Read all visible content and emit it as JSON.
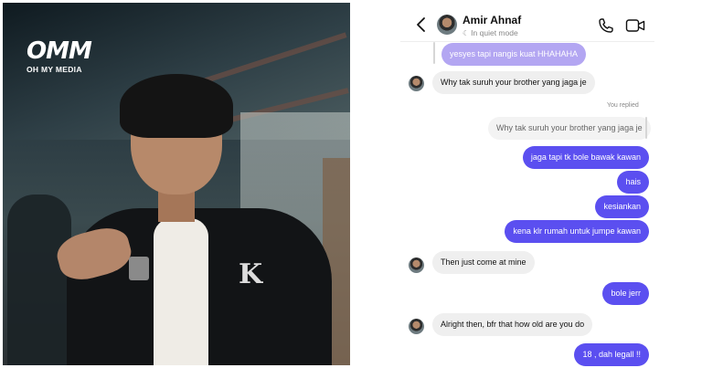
{
  "logo": {
    "mark": "OMM",
    "subtitle": "OH MY MEDIA"
  },
  "photo": {
    "patch_letter": "K"
  },
  "chat": {
    "contact_name": "Amir Ahnaf",
    "contact_status": "In quiet mode",
    "icons": {
      "back": "chevron-left-icon",
      "call": "phone-icon",
      "video": "video-camera-icon",
      "status": "moon-icon"
    },
    "colors": {
      "outgoing": "#5b4ff0",
      "incoming": "#efefef",
      "outgoing_faded": "#b3a6f2"
    },
    "reply_label": "You replied",
    "messages": [
      {
        "sender": "me",
        "text": "yesyes tapi nangis kuat HHAHAHA",
        "style": "faded"
      },
      {
        "sender": "them",
        "text": "Why tak suruh your brother yang jaga je"
      },
      {
        "sender": "me",
        "text": "Why tak suruh your brother yang jaga je",
        "style": "quoted"
      },
      {
        "sender": "me",
        "text": "jaga tapi tk bole bawak kawan"
      },
      {
        "sender": "me",
        "text": "hais"
      },
      {
        "sender": "me",
        "text": "kesiankan"
      },
      {
        "sender": "me",
        "text": "kena klr rumah untuk jumpe kawan"
      },
      {
        "sender": "them",
        "text": "Then just come at mine"
      },
      {
        "sender": "me",
        "text": "bole jerr"
      },
      {
        "sender": "them",
        "text": "Alright then, bfr that how old are you do"
      },
      {
        "sender": "me",
        "text": "18 , dah legall !!"
      }
    ]
  }
}
